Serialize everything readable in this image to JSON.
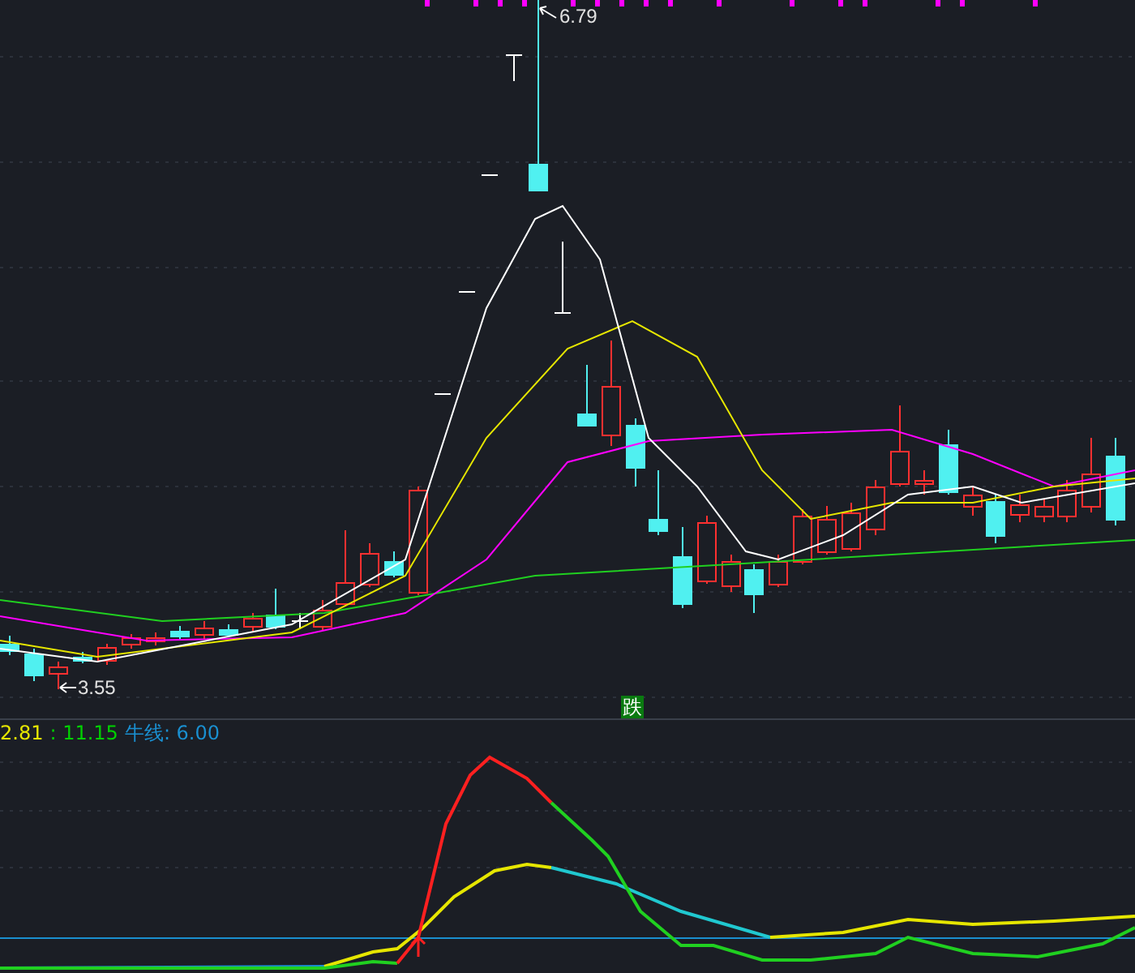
{
  "price_panel": {
    "high_label": "6.79",
    "low_label": "3.55",
    "signal_badge": "跌"
  },
  "indicator_panel": {
    "readouts": [
      {
        "text": "2.81",
        "color": "#e6e600"
      },
      {
        "text": ": 11.15",
        "color": "#00d000"
      },
      {
        "text": "牛线: 6.00",
        "color": "#1a8fd0"
      }
    ]
  }
}
